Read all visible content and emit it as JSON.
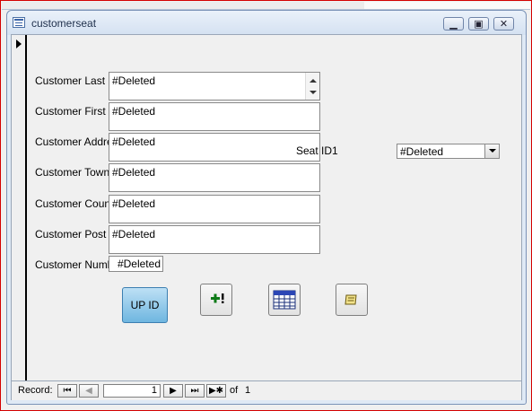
{
  "window": {
    "title": "customerseat"
  },
  "form": {
    "fields": [
      {
        "label": "Customer Last N",
        "value": "#Deleted"
      },
      {
        "label": "Customer First N",
        "value": "#Deleted"
      },
      {
        "label": "Customer Addre",
        "value": "#Deleted"
      },
      {
        "label": "Customer Town",
        "value": "#Deleted"
      },
      {
        "label": "Customer County",
        "value": "#Deleted"
      },
      {
        "label": "Customer Post C",
        "value": "#Deleted"
      },
      {
        "label": "Customer Numb",
        "value": "#Deleted"
      }
    ],
    "seat": {
      "label": "Seat ID1",
      "value": "#Deleted"
    },
    "buttons": {
      "up_id_label": "UP ID",
      "add_record_icon": "add-record-icon",
      "datasheet_icon": "datasheet-icon",
      "report_icon": "report-icon"
    }
  },
  "record_nav": {
    "label": "Record:",
    "current": "1",
    "of_label": "of",
    "total": "1"
  },
  "colors": {
    "accent": "#6fb6e0",
    "frame": "#d40000"
  }
}
